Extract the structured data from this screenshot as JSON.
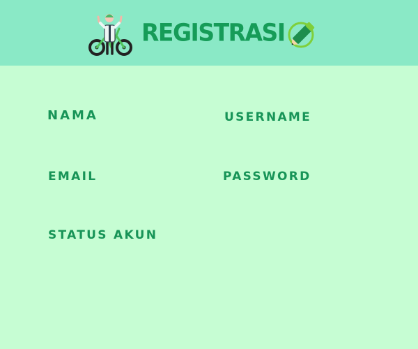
{
  "header": {
    "title": "REGISTRASI",
    "left_icon": "cyclist-icon",
    "right_icon": "pencil-icon",
    "background_color": "#8ae9c6",
    "title_color": "#169c58"
  },
  "form": {
    "background_color": "#c6fdd3",
    "label_color": "#179457",
    "fields": {
      "nama": "NAMA",
      "username": "USERNAME",
      "email": "EMAIL",
      "password": "PASSWORD",
      "status_akun": "STATUS AKUN"
    }
  }
}
